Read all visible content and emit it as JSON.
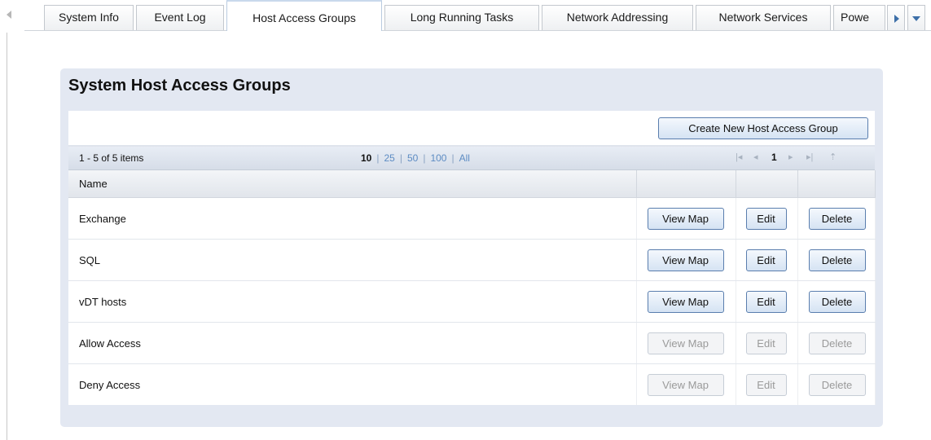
{
  "tabs": [
    {
      "label": "System Info",
      "active": false
    },
    {
      "label": "Event Log",
      "active": false
    },
    {
      "label": "Host Access Groups",
      "active": true
    },
    {
      "label": "Long Running Tasks",
      "active": false
    },
    {
      "label": "Network Addressing",
      "active": false
    },
    {
      "label": "Network Services",
      "active": false
    },
    {
      "label": "Powe",
      "active": false
    }
  ],
  "panel": {
    "title": "System Host Access Groups",
    "create_button": "Create New Host Access Group"
  },
  "pager": {
    "count_text": "1 - 5 of 5 items",
    "page_sizes": [
      "10",
      "25",
      "50",
      "100",
      "All"
    ],
    "current_page_size": "10",
    "first_icon": "first-page-icon",
    "prev_icon": "prev-page-icon",
    "current_page": "1",
    "next_icon": "next-page-icon",
    "last_icon": "last-page-icon",
    "up_icon": "scroll-top-icon"
  },
  "table": {
    "columns": [
      "Name",
      "",
      "",
      ""
    ],
    "rows": [
      {
        "name": "Exchange",
        "view": "View Map",
        "edit": "Edit",
        "delete": "Delete",
        "enabled": true
      },
      {
        "name": "SQL",
        "view": "View Map",
        "edit": "Edit",
        "delete": "Delete",
        "enabled": true
      },
      {
        "name": "vDT hosts",
        "view": "View Map",
        "edit": "Edit",
        "delete": "Delete",
        "enabled": true
      },
      {
        "name": "Allow Access",
        "view": "View Map",
        "edit": "Edit",
        "delete": "Delete",
        "enabled": false
      },
      {
        "name": "Deny Access",
        "view": "View Map",
        "edit": "Edit",
        "delete": "Delete",
        "enabled": false
      }
    ]
  },
  "colors": {
    "panel_bg": "#e3e8f2",
    "link": "#5d8cc3",
    "button_border": "#5a7eae"
  }
}
